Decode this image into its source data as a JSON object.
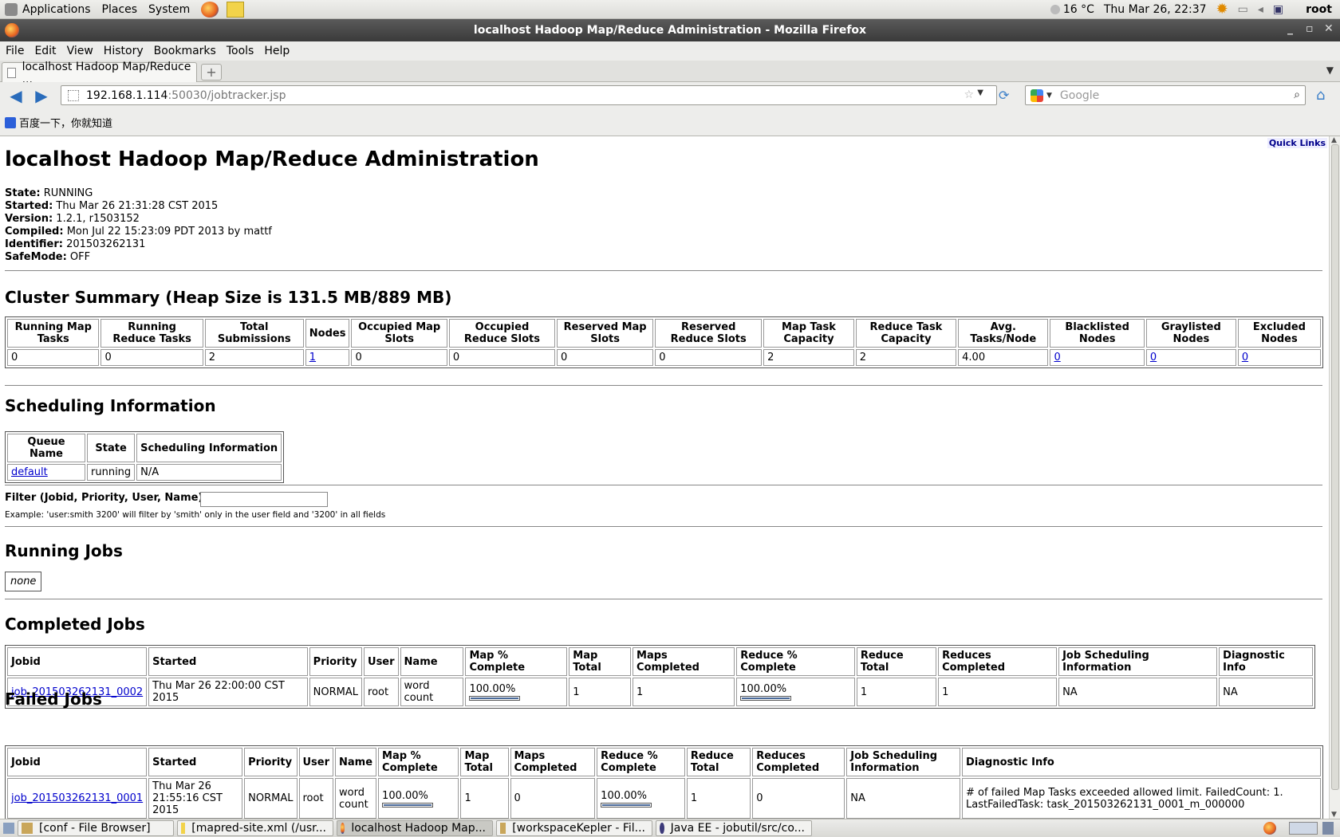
{
  "panel": {
    "menus": [
      "Applications",
      "Places",
      "System"
    ],
    "weather": "16 °C",
    "clock": "Thu Mar 26, 22:37",
    "user": "root"
  },
  "window": {
    "title": "localhost Hadoop Map/Reduce Administration - Mozilla Firefox"
  },
  "menubar": [
    "File",
    "Edit",
    "View",
    "History",
    "Bookmarks",
    "Tools",
    "Help"
  ],
  "tab": {
    "title": "localhost Hadoop Map/Reduce ..."
  },
  "urlbar": {
    "host": "192.168.1.114",
    "rest": ":50030/jobtracker.jsp"
  },
  "searchbar": {
    "placeholder": "Google"
  },
  "bookmarks": {
    "item1": "百度一下，你就知道"
  },
  "page": {
    "quick_links": "Quick Links",
    "title": "localhost Hadoop Map/Reduce Administration",
    "info": [
      {
        "label": "State:",
        "value": " RUNNING"
      },
      {
        "label": "Started:",
        "value": " Thu Mar 26 21:31:28 CST 2015"
      },
      {
        "label": "Version:",
        "value": " 1.2.1, r1503152"
      },
      {
        "label": "Compiled:",
        "value": " Mon Jul 22 15:23:09 PDT 2013 by mattf"
      },
      {
        "label": "Identifier:",
        "value": " 201503262131"
      },
      {
        "label": "SafeMode:",
        "value": " OFF"
      }
    ],
    "cluster_summary": {
      "heading": "Cluster Summary (Heap Size is 131.5 MB/889 MB)",
      "headers": [
        "Running Map Tasks",
        "Running Reduce Tasks",
        "Total Submissions",
        "Nodes",
        "Occupied Map Slots",
        "Occupied Reduce Slots",
        "Reserved Map Slots",
        "Reserved Reduce Slots",
        "Map Task Capacity",
        "Reduce Task Capacity",
        "Avg. Tasks/Node",
        "Blacklisted Nodes",
        "Graylisted Nodes",
        "Excluded Nodes"
      ],
      "values": [
        "0",
        "0",
        "2",
        "1",
        "0",
        "0",
        "0",
        "0",
        "2",
        "2",
        "4.00",
        "0",
        "0",
        "0"
      ]
    },
    "scheduling": {
      "heading": "Scheduling Information",
      "headers": [
        "Queue Name",
        "State",
        "Scheduling Information"
      ],
      "row": [
        "default",
        "running",
        "N/A"
      ]
    },
    "filter": {
      "label": "Filter (Jobid, Priority, User, Name)",
      "example": "Example: 'user:smith 3200' will filter by 'smith' only in the user field and '3200' in all fields",
      "value": ""
    },
    "running_jobs": {
      "heading": "Running Jobs",
      "none": "none"
    },
    "completed_jobs": {
      "heading": "Completed Jobs",
      "headers": [
        "Jobid",
        "Started",
        "Priority",
        "User",
        "Name",
        "Map % Complete",
        "Map Total",
        "Maps Completed",
        "Reduce % Complete",
        "Reduce Total",
        "Reduces Completed",
        "Job Scheduling Information",
        "Diagnostic Info"
      ],
      "row": {
        "jobid": "job_201503262131_0002",
        "started": "Thu Mar 26 22:00:00 CST 2015",
        "priority": "NORMAL",
        "user": "root",
        "name": "word count",
        "map_pct": "100.00%",
        "map_progress": 1.0,
        "map_total": "1",
        "maps_completed": "1",
        "reduce_pct": "100.00%",
        "reduce_progress": 1.0,
        "reduce_total": "1",
        "reduces_completed": "1",
        "sched_info": "NA",
        "diag": "NA"
      }
    },
    "failed_jobs": {
      "heading": "Failed Jobs",
      "headers": [
        "Jobid",
        "Started",
        "Priority",
        "User",
        "Name",
        "Map % Complete",
        "Map Total",
        "Maps Completed",
        "Reduce % Complete",
        "Reduce Total",
        "Reduces Completed",
        "Job Scheduling Information",
        "Diagnostic Info"
      ],
      "row": {
        "jobid": "job_201503262131_0001",
        "started": "Thu Mar 26 21:55:16 CST 2015",
        "priority": "NORMAL",
        "user": "root",
        "name": "word count",
        "map_pct": "100.00%",
        "map_progress": 1.0,
        "map_total": "1",
        "maps_completed": "0",
        "reduce_pct": "100.00%",
        "reduce_progress": 1.0,
        "reduce_total": "1",
        "reduces_completed": "0",
        "sched_info": "NA",
        "diag": "# of failed Map Tasks exceeded allowed limit. FailedCount: 1. LastFailedTask: task_201503262131_0001_m_000000"
      }
    }
  },
  "taskbar": [
    {
      "label": "[conf - File Browser]",
      "icon": "folder-icon"
    },
    {
      "label": "[mapred-site.xml (/usr...",
      "icon": "text-editor-icon"
    },
    {
      "label": "localhost Hadoop Map...",
      "icon": "firefox-icon",
      "active": true
    },
    {
      "label": "[workspaceKepler - Fil...",
      "icon": "folder-icon"
    },
    {
      "label": "Java EE - jobutil/src/co...",
      "icon": "eclipse-icon"
    }
  ]
}
